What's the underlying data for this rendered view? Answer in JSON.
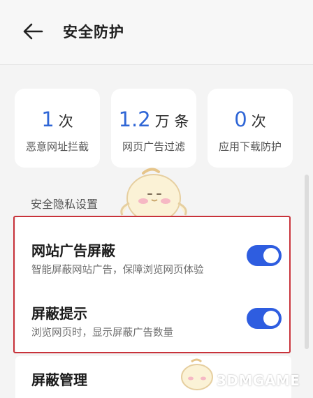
{
  "header": {
    "title": "安全防护",
    "back_icon": "arrow-left-icon"
  },
  "stats": [
    {
      "value": "1",
      "unit": "次",
      "label": "恶意网址拦截"
    },
    {
      "value": "1.2",
      "unit": "万 条",
      "label": "网页广告过滤"
    },
    {
      "value": "0",
      "unit": "次",
      "label": "应用下载防护"
    }
  ],
  "section": {
    "title": "安全隐私设置"
  },
  "settings": [
    {
      "title": "网站广告屏蔽",
      "desc": "智能屏蔽网站广告，保障浏览网页体验",
      "enabled": true
    },
    {
      "title": "屏蔽提示",
      "desc": "浏览网页时，显示屏蔽广告数量",
      "enabled": true
    }
  ],
  "management": {
    "title": "屏蔽管理"
  },
  "watermark": {
    "text": "3DMGAME"
  },
  "colors": {
    "accent": "#2f66d6",
    "toggle_on": "#2e5de0",
    "highlight": "#c8323a"
  }
}
